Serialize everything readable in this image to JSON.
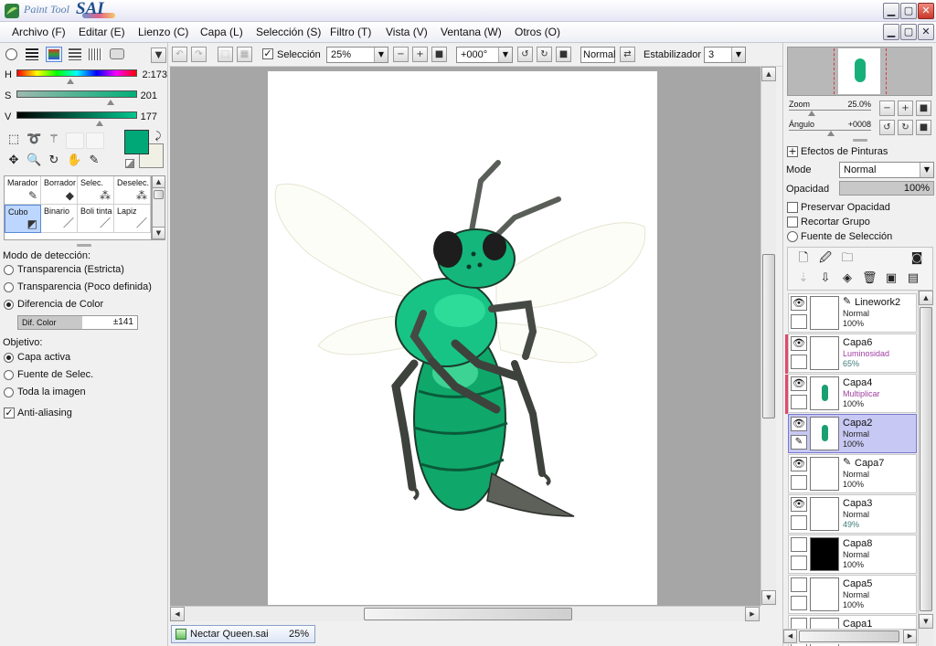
{
  "app": {
    "title_small": "Paint Tool",
    "title_big": "SAI"
  },
  "window_controls": {
    "minimize": "▁",
    "maximize": "▢",
    "close": "✕"
  },
  "menu": [
    "Archivo (F)",
    "Editar (E)",
    "Lienzo (C)",
    "Capa (L)",
    "Selección (S)",
    "Filtro (T)",
    "Vista (V)",
    "Ventana (W)",
    "Otros (O)"
  ],
  "color": {
    "h_label": "H",
    "h_value": "2:173",
    "s_label": "S",
    "s_value": "201",
    "v_label": "V",
    "v_value": "177",
    "primary": "#00a878",
    "secondary": "#f0f0e4"
  },
  "tools": [
    "Marador",
    "Borrador",
    "Selec.",
    "Deselec.",
    "Cubo",
    "Binario",
    "Boli tinta",
    "Lapiz"
  ],
  "detection": {
    "title": "Modo de detección:",
    "options": [
      "Transparencia (Estricta)",
      "Transparencia (Poco definida)",
      "Diferencia de Color"
    ],
    "selected": 2,
    "dif_label": "Dif. Color",
    "dif_value": "±141"
  },
  "target": {
    "title": "Objetivo:",
    "options": [
      "Capa activa",
      "Fuente de Selec.",
      "Toda la imagen"
    ],
    "selected": 0
  },
  "antialias": {
    "label": "Anti-aliasing",
    "checked": true
  },
  "toolbar": {
    "selection_label": "Selección",
    "zoom": "25%",
    "angle": "+000°",
    "mode": "Normal",
    "stabilizer_label": "Estabilizador",
    "stabilizer_value": "3"
  },
  "document_tab": {
    "name": "Nectar Queen.sai",
    "zoom": "25%"
  },
  "navigator": {
    "zoom_label": "Zoom",
    "zoom_value": "25.0%",
    "angle_label": "Ángulo",
    "angle_value": "+0008"
  },
  "layer_panel": {
    "effects_label": "Efectos de Pinturas",
    "mode_label": "Mode",
    "mode_value": "Normal",
    "opacity_label": "Opacidad",
    "opacity_value": "100%",
    "preserve_opacity": "Preservar Opacidad",
    "clip_group": "Recortar Grupo",
    "selection_source": "Fuente de Selección"
  },
  "layers": [
    {
      "name": "Linework2",
      "mode": "Normal",
      "opacity": "100%",
      "visible": true,
      "selected": false,
      "clip": false,
      "pen": true
    },
    {
      "name": "Capa6",
      "mode": "Luminosidad",
      "opacity": "65%",
      "visible": true,
      "selected": false,
      "clip": true,
      "pen": false
    },
    {
      "name": "Capa4",
      "mode": "Multiplicar",
      "opacity": "100%",
      "visible": true,
      "selected": false,
      "clip": true,
      "pen": false
    },
    {
      "name": "Capa2",
      "mode": "Normal",
      "opacity": "100%",
      "visible": true,
      "selected": true,
      "clip": false,
      "pen": false
    },
    {
      "name": "Capa7",
      "mode": "Normal",
      "opacity": "100%",
      "visible": true,
      "selected": false,
      "clip": false,
      "pen": true
    },
    {
      "name": "Capa3",
      "mode": "Normal",
      "opacity": "49%",
      "visible": true,
      "selected": false,
      "clip": false,
      "pen": false
    },
    {
      "name": "Capa8",
      "mode": "Normal",
      "opacity": "100%",
      "visible": false,
      "selected": false,
      "clip": false,
      "pen": false
    },
    {
      "name": "Capa5",
      "mode": "Normal",
      "opacity": "100%",
      "visible": false,
      "selected": false,
      "clip": false,
      "pen": false
    },
    {
      "name": "Capa1",
      "mode": "",
      "opacity": "",
      "visible": false,
      "selected": false,
      "clip": false,
      "pen": false
    }
  ],
  "accent": {
    "luminosity": "#a040a0",
    "multiply": "#a040a0",
    "opacity_low": "#3c7a7a",
    "selection": "#c8c8f4"
  }
}
